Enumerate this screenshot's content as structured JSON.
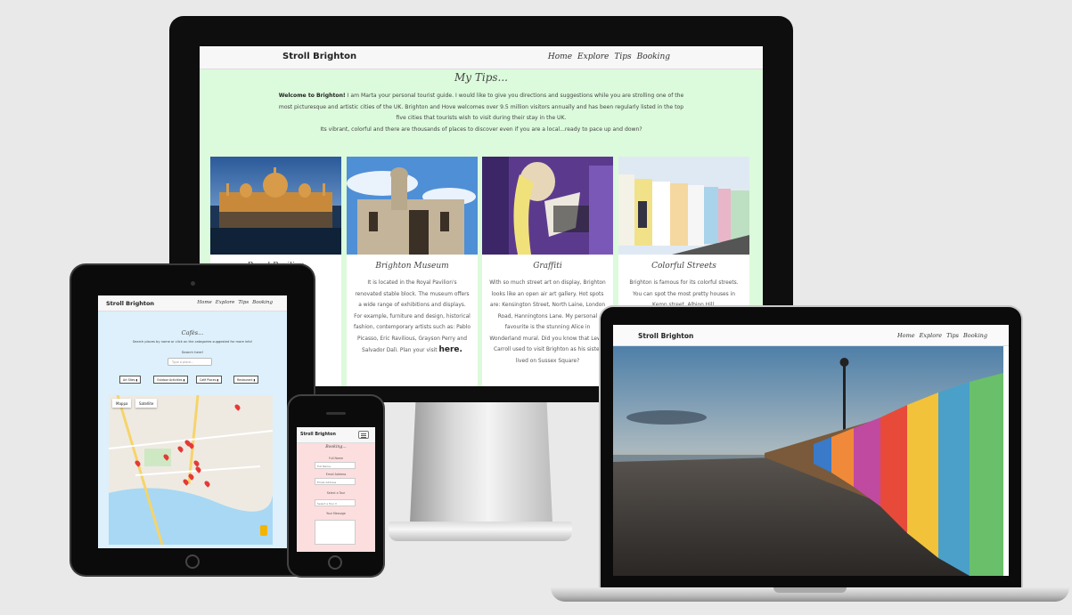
{
  "site": {
    "brand": "Stroll Brighton",
    "nav": [
      "Home",
      "Explore",
      "Tips",
      "Booking"
    ]
  },
  "tips_page": {
    "title": "My Tips...",
    "intro_bold": "Welcome to Brighton!",
    "intro_text": " I am Marta your personal tourist guide. I would like to give you directions and suggestions while you are strolling one of the most picturesque and artistic cities of the UK. Brighton and Hove welcomes over 9.5 million visitors annually and has been regularly listed in the top five cities that tourists wish to visit during their stay in the UK.",
    "intro_line2": "Its vibrant, colorful and there are thousands of places to discover even if you are a local...ready to pace up and down?",
    "cards": [
      {
        "title": "Royal Pavilion",
        "text": "",
        "link": ""
      },
      {
        "title": "Brighton Museum",
        "text": "It is located in the Royal Pavilion's renovated stable block. The museum offers a wide range of exhibitions and displays. For example, furniture and design, historical fashion, contemporary artists such as: Pablo Picasso, Eric Ravilious, Grayson Perry and Salvador Dalì. Plan your visit",
        "link": "here."
      },
      {
        "title": "Graffiti",
        "text": "With so much street art on display, Brighton looks like an open air art gallery. Hot spots are: Kensington Street, North Laine, London Road, Hanningtons Lane. My personal favourite is the stunning Alice in Wonderland mural. Did you know that Lewis Carroll used to visit Brighton as his sister lived on Sussex Square?",
        "link": ""
      },
      {
        "title": "Colorful Streets",
        "text": "Brighton is famous for its colorful streets. You can spot the most pretty houses in Kemp street, Albion Hill,",
        "link": ""
      }
    ]
  },
  "cafes_page": {
    "title": "Cafès...",
    "subtitle": "Search places by name or click on the categories suggested for more info!",
    "search_label": "Search here!",
    "search_placeholder": "Type a place...",
    "chips": [
      "Art Sites",
      "Outdoor Activities",
      "Café Places",
      "Restaurant"
    ],
    "map_tabs": [
      "Mappa",
      "Satellite"
    ]
  },
  "booking_page": {
    "title": "Booking...",
    "full_name_label": "Full Name",
    "full_name_placeholder": "Full Name",
    "email_label": "Email Address",
    "email_placeholder": "Email Address",
    "tour_label": "Select a Tour",
    "tour_value": "Select a Tour",
    "message_label": "Your Message"
  },
  "colors": {
    "tips_bg": "#dcfadc",
    "cafes_bg": "#ddf0fb",
    "booking_bg": "#fcdede",
    "page_bg": "#e9e9e9"
  }
}
